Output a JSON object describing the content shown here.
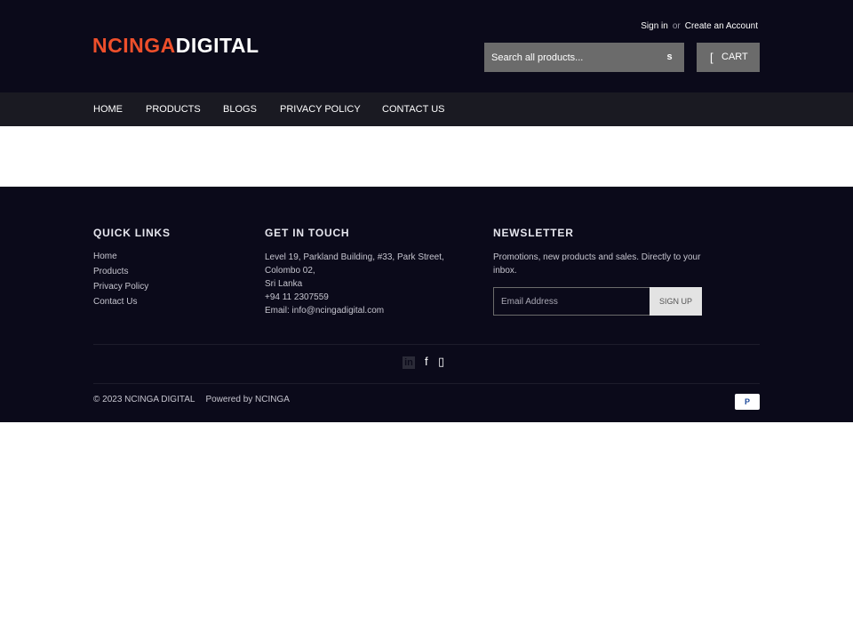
{
  "header": {
    "logo_part1": "NCINGA",
    "logo_part2": "DIGITAL",
    "signin": "Sign in",
    "or": "or",
    "create_account": "Create an Account",
    "search_placeholder": "Search all products...",
    "search_button": "s",
    "cart_icon": "[",
    "cart_label": "CART"
  },
  "nav": {
    "items": [
      "HOME",
      "PRODUCTS",
      "BLOGS",
      "PRIVACY POLICY",
      "CONTACT US"
    ]
  },
  "footer": {
    "quick_links_title": "QUICK LINKS",
    "quick_links": [
      "Home",
      "Products",
      "Privacy Policy",
      "Contact Us"
    ],
    "get_in_touch_title": "GET IN TOUCH",
    "address_line1": "Level 19, Parkland Building, #33, Park Street, Colombo 02,",
    "address_line2": "Sri Lanka",
    "phone": "+94 11 2307559",
    "email": "Email: info@ncingadigital.com",
    "newsletter_title": "NEWSLETTER",
    "newsletter_text": "Promotions, new products and sales. Directly to your inbox.",
    "newsletter_placeholder": "Email Address",
    "newsletter_button": "SIGN UP",
    "social_linkedin": "in",
    "social_facebook": "f",
    "social_instagram": "▯",
    "copyright": "© 2023 NCINGA DIGITAL",
    "powered": "Powered by NCINGA",
    "payment_icon": "P"
  },
  "colors": {
    "header_bg": "#0b0a1a",
    "nav_bg": "#1a1a22",
    "brand_orange": "#ee4f2b",
    "search_bg": "#6b6b6b"
  }
}
